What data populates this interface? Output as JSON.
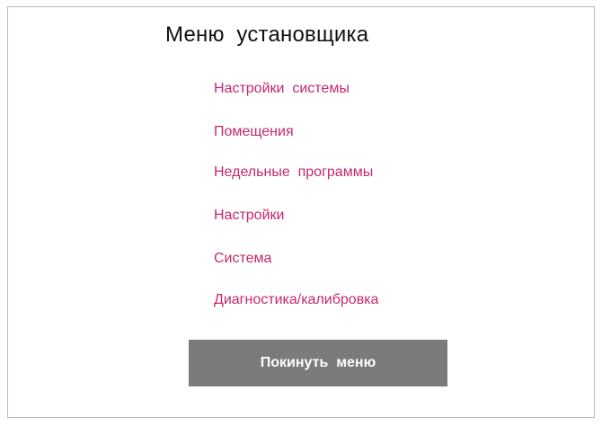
{
  "screen": {
    "title": "Меню  установщика"
  },
  "menu": {
    "items": [
      {
        "label": "Настройки  системы"
      },
      {
        "label": "Помещения"
      },
      {
        "label": "Недельные  программы"
      },
      {
        "label": "Настройки"
      },
      {
        "label": "Система"
      },
      {
        "label": "Диагностика/калибровка"
      }
    ]
  },
  "actions": {
    "exit_label": "Покинуть  меню"
  },
  "colors": {
    "menu_text": "#c4286f",
    "button_bg": "#7b7b7b",
    "button_text": "#ffffff",
    "border": "#b9b9b9"
  }
}
